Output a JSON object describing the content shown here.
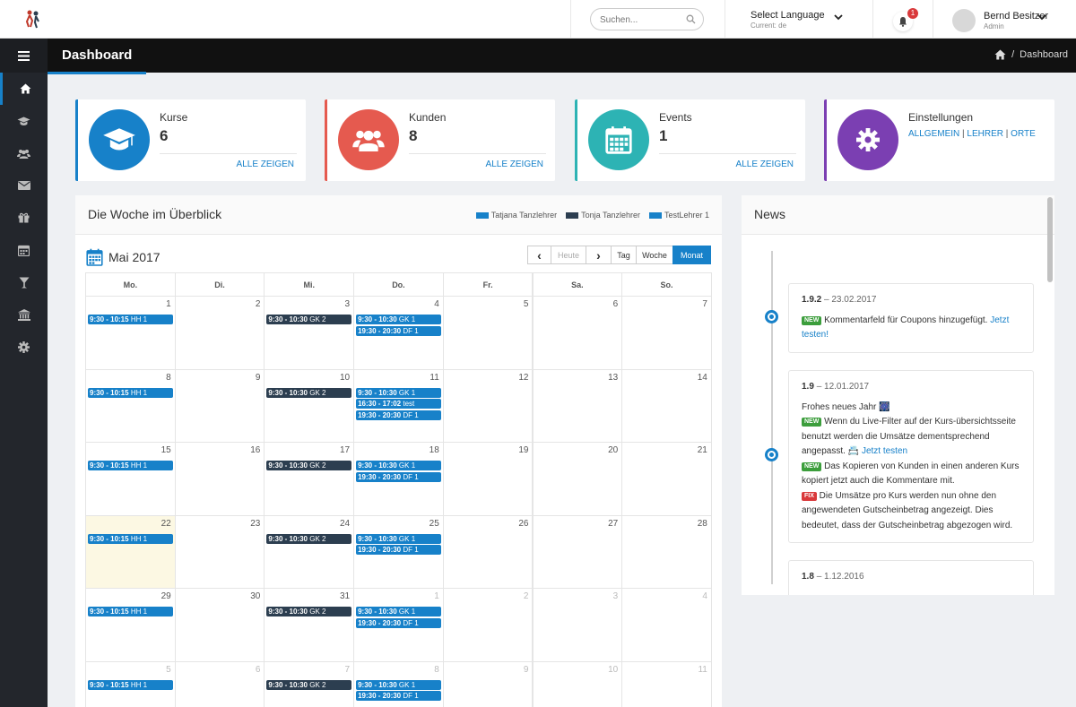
{
  "topbar": {
    "search_placeholder": "Suchen...",
    "language_title": "Select Language",
    "language_current": "Current: de",
    "notification_count": "1",
    "user_name": "Bernd Besitzer",
    "user_role": "Admin"
  },
  "sidebar": {
    "items": [
      {
        "icon": "home-icon",
        "active": true
      },
      {
        "icon": "graduation-cap-icon"
      },
      {
        "icon": "users-icon"
      },
      {
        "icon": "envelope-icon"
      },
      {
        "icon": "gift-icon"
      },
      {
        "icon": "calendar-icon"
      },
      {
        "icon": "cocktail-icon"
      },
      {
        "icon": "bank-icon"
      },
      {
        "icon": "gear-icon"
      }
    ]
  },
  "header": {
    "title": "Dashboard",
    "breadcrumb_sep": "/",
    "breadcrumb": "Dashboard"
  },
  "cards": {
    "kurse": {
      "label": "Kurse",
      "count": "6",
      "link": "ALLE ZEIGEN",
      "color": "#1781c9"
    },
    "kunden": {
      "label": "Kunden",
      "count": "8",
      "link": "ALLE ZEIGEN",
      "color": "#e55a4f"
    },
    "events": {
      "label": "Events",
      "count": "1",
      "link": "ALLE ZEIGEN",
      "color": "#2db3b4"
    },
    "einstellungen": {
      "label": "Einstellungen",
      "links": [
        "ALLGEMEIN",
        "LEHRER",
        "ORTE"
      ],
      "sep": "|",
      "color": "#7b3fb2"
    }
  },
  "calendar_panel": {
    "title": "Die Woche im Überblick",
    "legend": [
      {
        "name": "Tatjana Tanzlehrer",
        "color": "#1781c9"
      },
      {
        "name": "Tonja Tanzlehrer",
        "color": "#2c3e50"
      },
      {
        "name": "TestLehrer 1",
        "color": "#1781c9"
      }
    ],
    "month": "Mai 2017",
    "buttons": {
      "prev": "‹",
      "today": "Heute",
      "next": "›",
      "day": "Tag",
      "week": "Woche",
      "month": "Monat"
    },
    "weekdays": [
      "Mo.",
      "Di.",
      "Mi.",
      "Do.",
      "Fr.",
      "Sa.",
      "So."
    ],
    "weeks": [
      [
        {
          "d": "1",
          "events": [
            {
              "t": "9:30 - 10:15",
              "n": "HH 1",
              "c": "#1781c9"
            }
          ]
        },
        {
          "d": "2",
          "events": []
        },
        {
          "d": "3",
          "events": [
            {
              "t": "9:30 - 10:30",
              "n": "GK 2",
              "c": "#2c3e50"
            }
          ]
        },
        {
          "d": "4",
          "events": [
            {
              "t": "9:30 - 10:30",
              "n": "GK 1",
              "c": "#1781c9"
            },
            {
              "t": "19:30 - 20:30",
              "n": "DF 1",
              "c": "#1781c9"
            }
          ]
        },
        {
          "d": "5",
          "events": []
        },
        {
          "d": "6",
          "events": []
        },
        {
          "d": "7",
          "events": []
        }
      ],
      [
        {
          "d": "8",
          "events": [
            {
              "t": "9:30 - 10:15",
              "n": "HH 1",
              "c": "#1781c9"
            }
          ]
        },
        {
          "d": "9",
          "events": []
        },
        {
          "d": "10",
          "events": [
            {
              "t": "9:30 - 10:30",
              "n": "GK 2",
              "c": "#2c3e50"
            }
          ]
        },
        {
          "d": "11",
          "events": [
            {
              "t": "9:30 - 10:30",
              "n": "GK 1",
              "c": "#1781c9"
            },
            {
              "t": "16:30 - 17:02",
              "n": "test",
              "c": "#1781c9"
            },
            {
              "t": "19:30 - 20:30",
              "n": "DF 1",
              "c": "#1781c9"
            }
          ]
        },
        {
          "d": "12",
          "events": []
        },
        {
          "d": "13",
          "events": []
        },
        {
          "d": "14",
          "events": []
        }
      ],
      [
        {
          "d": "15",
          "events": [
            {
              "t": "9:30 - 10:15",
              "n": "HH 1",
              "c": "#1781c9"
            }
          ]
        },
        {
          "d": "16",
          "events": []
        },
        {
          "d": "17",
          "events": [
            {
              "t": "9:30 - 10:30",
              "n": "GK 2",
              "c": "#2c3e50"
            }
          ]
        },
        {
          "d": "18",
          "events": [
            {
              "t": "9:30 - 10:30",
              "n": "GK 1",
              "c": "#1781c9"
            },
            {
              "t": "19:30 - 20:30",
              "n": "DF 1",
              "c": "#1781c9"
            }
          ]
        },
        {
          "d": "19",
          "events": []
        },
        {
          "d": "20",
          "events": []
        },
        {
          "d": "21",
          "events": []
        }
      ],
      [
        {
          "d": "22",
          "today": true,
          "events": [
            {
              "t": "9:30 - 10:15",
              "n": "HH 1",
              "c": "#1781c9"
            }
          ]
        },
        {
          "d": "23",
          "events": []
        },
        {
          "d": "24",
          "events": [
            {
              "t": "9:30 - 10:30",
              "n": "GK 2",
              "c": "#2c3e50"
            }
          ]
        },
        {
          "d": "25",
          "events": [
            {
              "t": "9:30 - 10:30",
              "n": "GK 1",
              "c": "#1781c9"
            },
            {
              "t": "19:30 - 20:30",
              "n": "DF 1",
              "c": "#1781c9"
            }
          ]
        },
        {
          "d": "26",
          "events": []
        },
        {
          "d": "27",
          "events": []
        },
        {
          "d": "28",
          "events": []
        }
      ],
      [
        {
          "d": "29",
          "events": [
            {
              "t": "9:30 - 10:15",
              "n": "HH 1",
              "c": "#1781c9"
            }
          ]
        },
        {
          "d": "30",
          "events": []
        },
        {
          "d": "31",
          "events": [
            {
              "t": "9:30 - 10:30",
              "n": "GK 2",
              "c": "#2c3e50"
            }
          ]
        },
        {
          "d": "1",
          "other": true,
          "events": [
            {
              "t": "9:30 - 10:30",
              "n": "GK 1",
              "c": "#1781c9"
            },
            {
              "t": "19:30 - 20:30",
              "n": "DF 1",
              "c": "#1781c9"
            }
          ]
        },
        {
          "d": "2",
          "other": true,
          "events": []
        },
        {
          "d": "3",
          "other": true,
          "events": []
        },
        {
          "d": "4",
          "other": true,
          "events": []
        }
      ],
      [
        {
          "d": "5",
          "other": true,
          "events": [
            {
              "t": "9:30 - 10:15",
              "n": "HH 1",
              "c": "#1781c9"
            }
          ]
        },
        {
          "d": "6",
          "other": true,
          "events": []
        },
        {
          "d": "7",
          "other": true,
          "events": [
            {
              "t": "9:30 - 10:30",
              "n": "GK 2",
              "c": "#2c3e50"
            }
          ]
        },
        {
          "d": "8",
          "other": true,
          "events": [
            {
              "t": "9:30 - 10:30",
              "n": "GK 1",
              "c": "#1781c9"
            },
            {
              "t": "19:30 - 20:30",
              "n": "DF 1",
              "c": "#1781c9"
            }
          ]
        },
        {
          "d": "9",
          "other": true,
          "events": []
        },
        {
          "d": "10",
          "other": true,
          "events": []
        },
        {
          "d": "11",
          "other": true,
          "events": []
        }
      ]
    ]
  },
  "news": {
    "title": "News",
    "items": [
      {
        "version": "1.9.2",
        "date": "– 23.02.2017",
        "lines": [
          [
            {
              "tag": "NEW",
              "kind": "new"
            },
            {
              "text": " Kommentarfeld für Coupons hinzugefügt. "
            },
            {
              "text": "Jetzt testen!",
              "link": true
            }
          ]
        ]
      },
      {
        "version": "1.9",
        "date": "– 12.01.2017",
        "lines": [
          [
            {
              "text": "Frohes neues Jahr 🎆"
            }
          ],
          [
            {
              "tag": "NEW",
              "kind": "new"
            },
            {
              "text": " Wenn du Live-Filter auf der Kurs-übersichtsseite benutzt werden die Umsätze dementsprechend angepasst. 📇 "
            },
            {
              "text": "Jetzt testen",
              "link": true
            }
          ],
          [
            {
              "tag": "NEW",
              "kind": "new"
            },
            {
              "text": " Das Kopieren von Kunden in einen anderen Kurs kopiert jetzt auch die Kommentare mit."
            }
          ],
          [
            {
              "tag": "FIX",
              "kind": "fix"
            },
            {
              "text": " Die Umsätze pro Kurs werden nun ohne den angewendeten Gutscheinbetrag angezeigt. Dies bedeutet, dass der Gutscheinbetrag abgezogen wird."
            }
          ]
        ]
      },
      {
        "version": "1.8",
        "date": "– 1.12.2016",
        "lines": []
      }
    ]
  }
}
